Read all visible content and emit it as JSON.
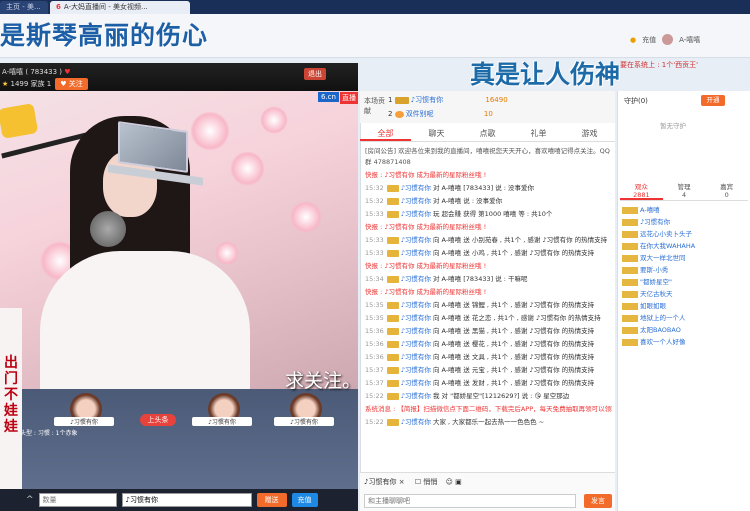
{
  "browser": {
    "tabs": [
      "主页 - 美...",
      "A-大妈直播间 - 美女视频..."
    ]
  },
  "danmu": {
    "line1": "是斯琴高丽的伤心",
    "line2": "真是让人伤神",
    "line3": "求关注。"
  },
  "user": {
    "recharge": "充值",
    "name": "A-嘻嘻"
  },
  "marquee": "要在系统上 : 1个'西贡王'",
  "anchor": {
    "name": "A-嘻嘻 ( 783433 )",
    "fans": "1499",
    "level_text": "家族 1",
    "follow": "关注",
    "exit": "退出"
  },
  "video": {
    "logo": "6.cn",
    "live": "直播"
  },
  "podium": {
    "card1": "♪习惯有你",
    "card2": "♪习惯有你",
    "card3": "♪习惯有你",
    "toptag": "上头条",
    "info": "头型 : 习惯 : 1个赤象",
    "side_text": "出门不娃娃"
  },
  "left_bottom": {
    "input1_placeholder": "数量",
    "input2_value": "♪习惯有你",
    "gift_btn": "赠送",
    "recharge_btn": "充值"
  },
  "ranks": {
    "label": "本场贡献",
    "row1_user": "♪习惯有你",
    "row1_value": "16490",
    "row2_user": "双件别呢",
    "row2_value": "10"
  },
  "chat_tabs": [
    "全部",
    "聊天",
    "点歌",
    "礼单",
    "游戏"
  ],
  "chat": {
    "notice": "[房间公告] 欢迎各位来到我的直播间，嘻嘻祝您天天开心，喜欢嘻嘻记得点关注。QQ群 478871408",
    "messages": [
      {
        "type": "sys",
        "text": "快报 : ♪习惯有你 成为最新的星际粉丝哦 !"
      },
      {
        "type": "msg",
        "time": "15:32",
        "user": "♪习惯有你",
        "text": "对 A-嘻嘻 [783433] 说 : 没事爱你"
      },
      {
        "type": "msg",
        "time": "15:32",
        "user": "♪习惯有你",
        "text": "对 A-嘻嘻 说 : 没事爱你"
      },
      {
        "type": "msg",
        "time": "15:33",
        "user": "♪习惯有你",
        "text": "玩 超会赚 获得 第1000 嘻嘻 等 : 共10个"
      },
      {
        "type": "sys",
        "text": "快报 : ♪习惯有你 成为最新的星际粉丝哦 !"
      },
      {
        "type": "msg",
        "time": "15:33",
        "user": "♪习惯有你",
        "text": "向 A-嘻嘻 送 小别苑春 , 共1个 , 感谢 ♪习惯有你 的热情支持"
      },
      {
        "type": "msg",
        "time": "15:33",
        "user": "♪习惯有你",
        "text": "向 A-嘻嘻 送 小鸡 , 共1个 , 感谢 ♪习惯有你 的热情支持"
      },
      {
        "type": "sys",
        "text": "快报 : ♪习惯有你 成为最新的星际粉丝哦 !"
      },
      {
        "type": "msg",
        "time": "15:34",
        "user": "♪习惯有你",
        "text": "对 A-嘻嘻 [783433] 说 : 干嘛呢"
      },
      {
        "type": "sys",
        "text": "快报 : ♪习惯有你 成为最新的星际粉丝哦 !"
      },
      {
        "type": "msg",
        "time": "15:35",
        "user": "♪习惯有你",
        "text": "向 A-嘻嘻 送 锦鲤 , 共1个 , 感谢 ♪习惯有你 的热情支持"
      },
      {
        "type": "msg",
        "time": "15:35",
        "user": "♪习惯有你",
        "text": "向 A-嘻嘻 送 花之恋 , 共1个 , 感谢 ♪习惯有你 的热情支持"
      },
      {
        "type": "msg",
        "time": "15:36",
        "user": "♪习惯有你",
        "text": "向 A-嘻嘻 送 黑猫 , 共1个 , 感谢 ♪习惯有你 的热情支持"
      },
      {
        "type": "msg",
        "time": "15:36",
        "user": "♪习惯有你",
        "text": "向 A-嘻嘻 送 樱花 , 共1个 , 感谢 ♪习惯有你 的热情支持"
      },
      {
        "type": "msg",
        "time": "15:36",
        "user": "♪习惯有你",
        "text": "向 A-嘻嘻 送 文具 , 共1个 , 感谢 ♪习惯有你 的热情支持"
      },
      {
        "type": "msg",
        "time": "15:37",
        "user": "♪习惯有你",
        "text": "向 A-嘻嘻 送 元宝 , 共1个 , 感谢 ♪习惯有你 的热情支持"
      },
      {
        "type": "msg",
        "time": "15:37",
        "user": "♪习惯有你",
        "text": "向 A-嘻嘻 送 发财 , 共1个 , 感谢 ♪习惯有你 的热情支持"
      },
      {
        "type": "msg",
        "time": "15:22",
        "user": "♪习惯有你",
        "text": "我 对 \"都娇星空\"[1212629?] 说 : 😘 星空那边"
      },
      {
        "type": "sys",
        "text": "系统消息 : 【简报】扫描微信点下面二维码，下载完后APP，每天免费抽取再领可以领取高质礼物哦 !"
      },
      {
        "type": "msg",
        "time": "15:22",
        "user": "♪习惯有你",
        "text": "大家 , 大家都乐一起去热一一色色色 ~"
      }
    ]
  },
  "chatbox": {
    "target": "♪习惯有你",
    "private": "悄悄",
    "placeholder": "和主播聊聊吧",
    "send": "发言"
  },
  "guard": {
    "title": "守护(0)",
    "open": "开通",
    "none": "暂无守护"
  },
  "audience_tabs": [
    {
      "label": "观众",
      "count": "2881"
    },
    {
      "label": "管理",
      "count": "4"
    },
    {
      "label": "嘉宾",
      "count": "0"
    }
  ],
  "audience": [
    {
      "name": "A-嘻嘻"
    },
    {
      "name": "♪习惯有你"
    },
    {
      "name": "远花心小卖卜头子"
    },
    {
      "name": "在你大我WAHAHA"
    },
    {
      "name": "双大一样北世同"
    },
    {
      "name": "要斯-小秀"
    },
    {
      "name": "\"都娇星空\""
    },
    {
      "name": "天亿古秋天"
    },
    {
      "name": "如眼如眼"
    },
    {
      "name": "地狱上的一个人"
    },
    {
      "name": "太阳BAOBAO"
    },
    {
      "name": "喜欢一个人好像"
    }
  ]
}
